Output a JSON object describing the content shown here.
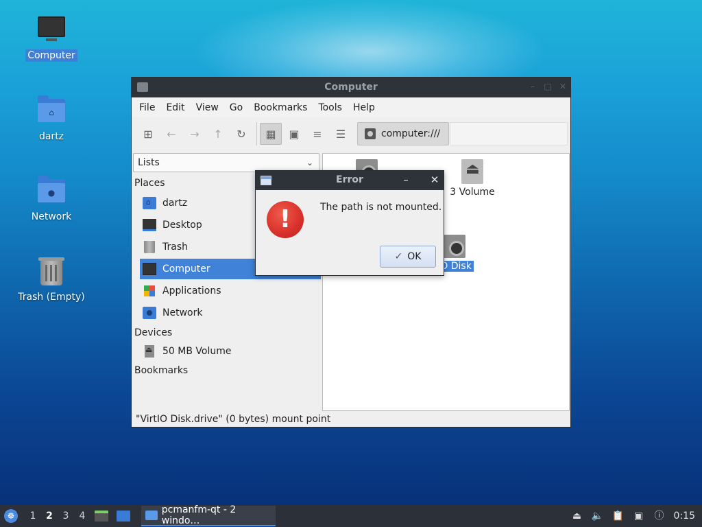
{
  "desktop": {
    "icons": [
      {
        "label": "Computer",
        "icon": "computer-icon"
      },
      {
        "label": "dartz",
        "icon": "home-folder-icon"
      },
      {
        "label": "Network",
        "icon": "network-folder-icon"
      },
      {
        "label": "Trash (Empty)",
        "icon": "trash-icon"
      }
    ]
  },
  "window": {
    "title": "Computer",
    "menu": [
      "File",
      "Edit",
      "View",
      "Go",
      "Bookmarks",
      "Tools",
      "Help"
    ],
    "path": "computer:///",
    "side_combo": "Lists",
    "places_heading": "Places",
    "places": [
      "dartz",
      "Desktop",
      "Trash",
      "Computer",
      "Applications",
      "Network"
    ],
    "devices_heading": "Devices",
    "devices": [
      "50 MB Volume"
    ],
    "bookmarks_heading": "Bookmarks",
    "files": [
      "3 Volume",
      "IO Disk"
    ],
    "status": "\"VirtIO Disk.drive\" (0 bytes) mount point"
  },
  "dialog": {
    "title": "Error",
    "message": "The path is not mounted.",
    "ok_label": "OK",
    "minimize": "–",
    "close": "✕"
  },
  "taskbar": {
    "workspaces": [
      "1",
      "2",
      "3",
      "4"
    ],
    "current_workspace": "2",
    "task_label": "pcmanfm-qt - 2 windo…",
    "clock": "0:15"
  }
}
